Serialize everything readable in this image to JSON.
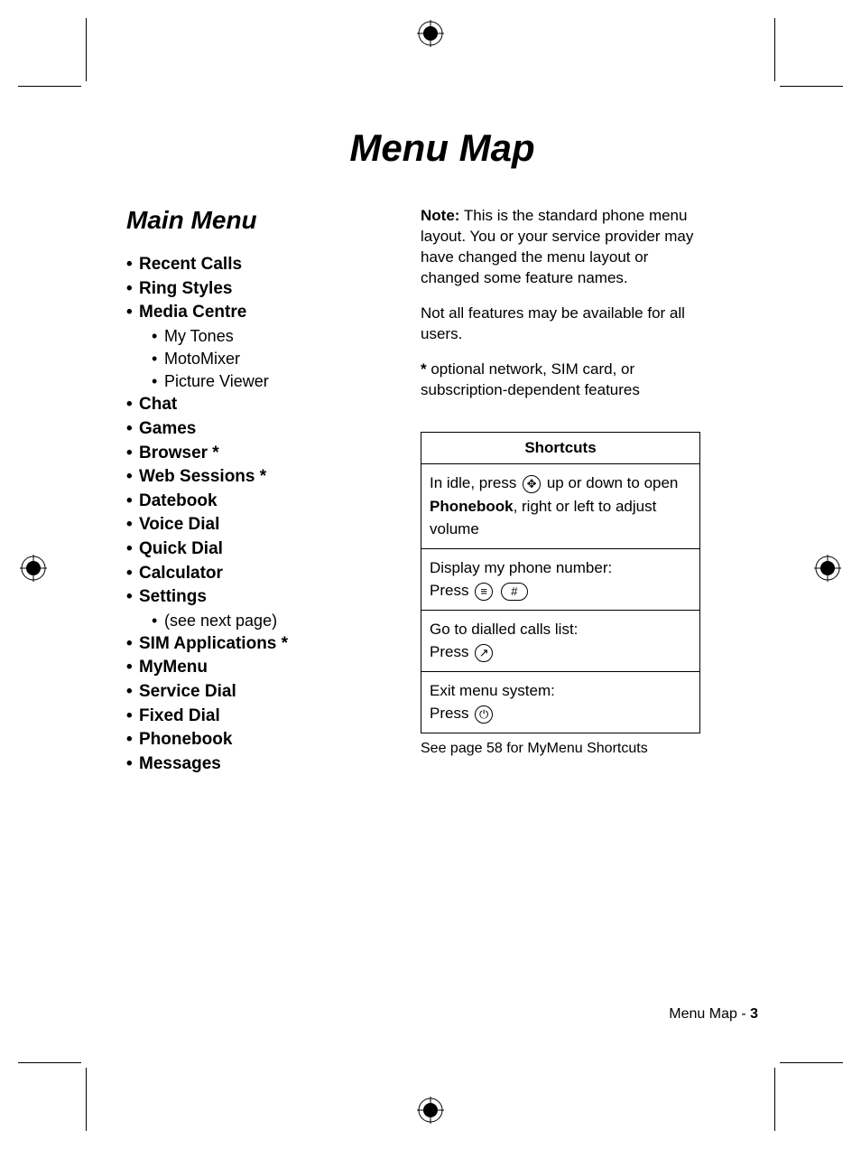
{
  "title": "Menu Map",
  "section_title": "Main Menu",
  "menu_items": [
    {
      "label": "Recent Calls"
    },
    {
      "label": "Ring Styles"
    },
    {
      "label": "Media Centre",
      "children": [
        {
          "label": "My Tones"
        },
        {
          "label": "MotoMixer"
        },
        {
          "label": "Picture Viewer"
        }
      ]
    },
    {
      "label": "Chat"
    },
    {
      "label": "Games"
    },
    {
      "label": "Browser *"
    },
    {
      "label": "Web Sessions *"
    },
    {
      "label": "Datebook"
    },
    {
      "label": "Voice Dial"
    },
    {
      "label": "Quick Dial"
    },
    {
      "label": "Calculator"
    },
    {
      "label": "Settings",
      "children": [
        {
          "label": "(see next page)"
        }
      ]
    },
    {
      "label": "SIM Applications *"
    },
    {
      "label": "MyMenu"
    },
    {
      "label": "Service Dial"
    },
    {
      "label": "Fixed Dial"
    },
    {
      "label": "Phonebook"
    },
    {
      "label": "Messages"
    }
  ],
  "right": {
    "note_label": "Note:",
    "note_text": " This is the standard phone menu layout. You or your service provider may have changed the menu layout or changed some feature names.",
    "avail_text": "Not all features may be available for all users.",
    "star_label": "*",
    "star_text": " optional network, SIM card, or subscription-dependent features"
  },
  "shortcuts": {
    "header": "Shortcuts",
    "row1_a": "In idle, press ",
    "row1_b": " up or down to open ",
    "row1_c": "Phonebook",
    "row1_d": ", right or left to adjust volume",
    "row2_a": "Display my phone number:",
    "row2_b": "Press ",
    "row3_a": "Go to dialled calls list:",
    "row3_b": "Press ",
    "row4_a": "Exit menu system:",
    "row4_b": "Press ",
    "caption": "See page 58 for MyMenu Shortcuts",
    "key_nav": "✥",
    "key_menu": "≡",
    "key_hash": "#",
    "key_send": "↗",
    "key_end": "⏻"
  },
  "footer": {
    "label": "Menu Map - ",
    "page": "3"
  }
}
